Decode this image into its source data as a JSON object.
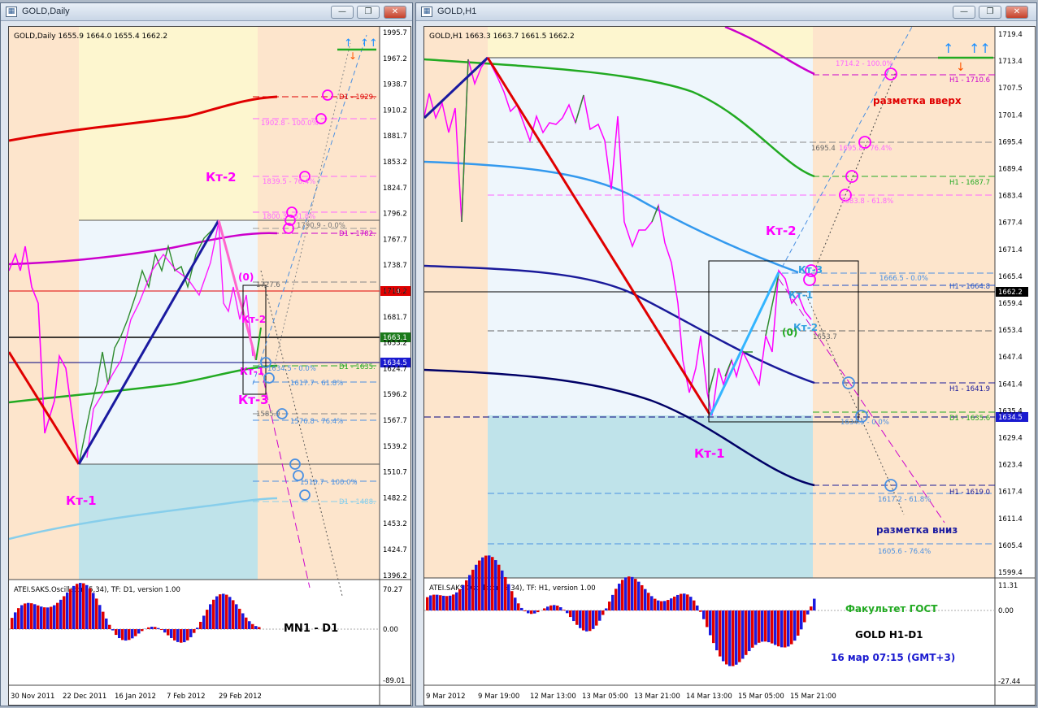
{
  "left_window": {
    "title": "GOLD,Daily",
    "info": "GOLD,Daily  1655.9 1664.0 1655.4 1662.2",
    "price_ticks": [
      "1995.7",
      "1967.2",
      "1938.7",
      "1910.2",
      "1881.7",
      "1853.2",
      "1824.7",
      "1796.2",
      "1767.7",
      "1738.7",
      "1710.2",
      "1681.7",
      "1653.2",
      "1624.7",
      "1596.2",
      "1567.7",
      "1539.2",
      "1510.7",
      "1482.2",
      "1453.2",
      "1424.7",
      "1396.2"
    ],
    "price_tags": {
      "p1714": "1714.2",
      "p1663": "1663.1",
      "p1634": "1634.5"
    },
    "levels": {
      "d1929": "D1 - 1929.",
      "l1902": "1902.8 - 100.0%",
      "l1839": "1839.5 - 76.4%",
      "l1800": "1800.3 - 61.8%",
      "l1790": "1790.9 - 0.0%",
      "d1782": "D1 - 1782.",
      "l1727": "1727.6",
      "l1634": "1634.5 - 0.0%",
      "d1635": "D1 - 1635.",
      "l1617": "1617.7 - 61.8%",
      "l1585": "1585.9",
      "l1576": "1576.8 - 76.4%",
      "l1510": "1510.7 - 100.0%",
      "d1488": "D1 - 1488."
    },
    "labels": {
      "kt1": "Кт-1",
      "kt2_top": "Кт-2",
      "kt2_mid": "Кт-2",
      "kt1_small": "Кт-1",
      "kt3": "Кт-3",
      "zero": "(0)"
    },
    "osc_title": "ATEI.SAKS.Oscillator (5,34), TF: D1,  version 1.00",
    "osc_ticks": [
      "70.27",
      "0.00",
      "-89.01"
    ],
    "osc_caption": "MN1 - D1",
    "date_ticks": [
      "30 Nov 2011",
      "22 Dec 2011",
      "16 Jan 2012",
      "7 Feb 2012",
      "29 Feb 2012"
    ]
  },
  "right_window": {
    "title": "GOLD,H1",
    "info": "GOLD,H1  1663.3 1663.7 1661.5 1662.2",
    "price_ticks": [
      "1719.4",
      "1713.4",
      "1707.5",
      "1701.4",
      "1695.4",
      "1689.4",
      "1683.4",
      "1677.4",
      "1671.4",
      "1665.4",
      "1659.4",
      "1653.4",
      "1647.4",
      "1641.4",
      "1635.4",
      "1629.4",
      "1623.4",
      "1617.4",
      "1611.4",
      "1605.4",
      "1599.4"
    ],
    "price_tags": {
      "p1662": "1662.2",
      "p1634": "1634.5"
    },
    "levels": {
      "l1714": "1714.2 - 100.0%",
      "h1710": "H1 - 1710.6",
      "l1695a": "1695.4",
      "l1695b": "1695.8 - 76.4%",
      "h1687": "H1 - 1687.7",
      "l1683": "1683.8 - 61.8%",
      "l1666": "1666.5 - 0.0%",
      "h1664": "H1 - 1664.8",
      "l1653": "1653.7",
      "h1641": "H1 - 1641.9",
      "l1634": "1634.5 - 0.0%",
      "d1635": "D1 - 1635.6",
      "l1617": "1617.2 - 61.8%",
      "h1619": "H1 - 1619.0",
      "l1605": "1605.6 - 76.4%"
    },
    "labels": {
      "kt1": "Кт-1",
      "kt2": "Кт-2",
      "kt3": "Кт-3",
      "kt1_small": "Кт-1",
      "kt2_small": "Кт-2",
      "zero": "(0)",
      "up": "разметка вверх",
      "down": "разметка вниз"
    },
    "osc_title": "ATEI.SAKS.Oscillator (5,34), TF: H1,  version 1.00",
    "osc_ticks": [
      "11.31",
      "0.00",
      "-27.44"
    ],
    "captions": {
      "faculty": "Факультет ГОСТ",
      "symbol": "GOLD   H1-D1",
      "time": "16 мар 07:15 (GMT+3)"
    },
    "date_ticks": [
      "9 Mar 2012",
      "9 Mar 19:00",
      "12 Mar 13:00",
      "13 Mar 05:00",
      "13 Mar 21:00",
      "14 Mar 13:00",
      "15 Mar 05:00",
      "15 Mar 21:00"
    ]
  },
  "buttons": {
    "minimize": "—",
    "restore": "❐",
    "close": "✕"
  },
  "colors": {
    "red": "#e00000",
    "magenta": "#ff00ff",
    "blue": "#1e90ff",
    "green": "#22aa22",
    "navy": "#00007a"
  }
}
